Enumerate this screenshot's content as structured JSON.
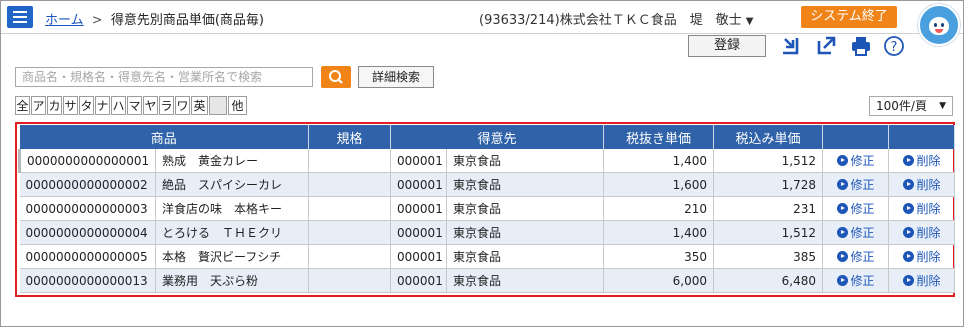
{
  "header": {
    "home_label": "ホーム",
    "separator": ">",
    "page_title": "得意先別商品単価(商品毎)",
    "user_info": "(93633/214)株式会社ＴＫＣ食品　堤　敬士",
    "user_dropdown_icon": "caret-down-icon",
    "end_button": "システム終了",
    "accent_color": "#f08419",
    "brand_color": "#1f66c7"
  },
  "toolbar": {
    "register_label": "登録",
    "icons": [
      "import-icon",
      "export-icon",
      "print-icon",
      "help-icon"
    ]
  },
  "search": {
    "placeholder": "商品名・規格名・得意先名・営業所名で検索",
    "detail_label": "詳細検索"
  },
  "kana_filter": [
    "全",
    "ア",
    "カ",
    "サ",
    "タ",
    "ナ",
    "ハ",
    "マ",
    "ヤ",
    "ラ",
    "ワ",
    "英",
    "",
    "他"
  ],
  "per_page": "100件/頁",
  "table": {
    "columns": [
      "商品",
      "規格",
      "得意先",
      "税抜き単価",
      "税込み単価",
      "",
      ""
    ],
    "rows": [
      {
        "code": "0000000000000001",
        "name": "熟成　黄金カレー",
        "spec": "",
        "cust_code": "000001",
        "cust_name": "東京食品",
        "price_ex": "1,400",
        "price_in": "1,512",
        "edit": "修正",
        "delete": "削除"
      },
      {
        "code": "0000000000000002",
        "name": "絶品　スパイシーカレ",
        "spec": "",
        "cust_code": "000001",
        "cust_name": "東京食品",
        "price_ex": "1,600",
        "price_in": "1,728",
        "edit": "修正",
        "delete": "削除"
      },
      {
        "code": "0000000000000003",
        "name": "洋食店の味　本格キー",
        "spec": "",
        "cust_code": "000001",
        "cust_name": "東京食品",
        "price_ex": "210",
        "price_in": "231",
        "edit": "修正",
        "delete": "削除"
      },
      {
        "code": "0000000000000004",
        "name": "とろける　ＴＨＥクリ",
        "spec": "",
        "cust_code": "000001",
        "cust_name": "東京食品",
        "price_ex": "1,400",
        "price_in": "1,512",
        "edit": "修正",
        "delete": "削除"
      },
      {
        "code": "0000000000000005",
        "name": "本格　贅沢ビーフシチ",
        "spec": "",
        "cust_code": "000001",
        "cust_name": "東京食品",
        "price_ex": "350",
        "price_in": "385",
        "edit": "修正",
        "delete": "削除"
      },
      {
        "code": "0000000000000013",
        "name": "業務用　天ぷら粉",
        "spec": "",
        "cust_code": "000001",
        "cust_name": "東京食品",
        "price_ex": "6,000",
        "price_in": "6,480",
        "edit": "修正",
        "delete": "削除"
      }
    ]
  }
}
